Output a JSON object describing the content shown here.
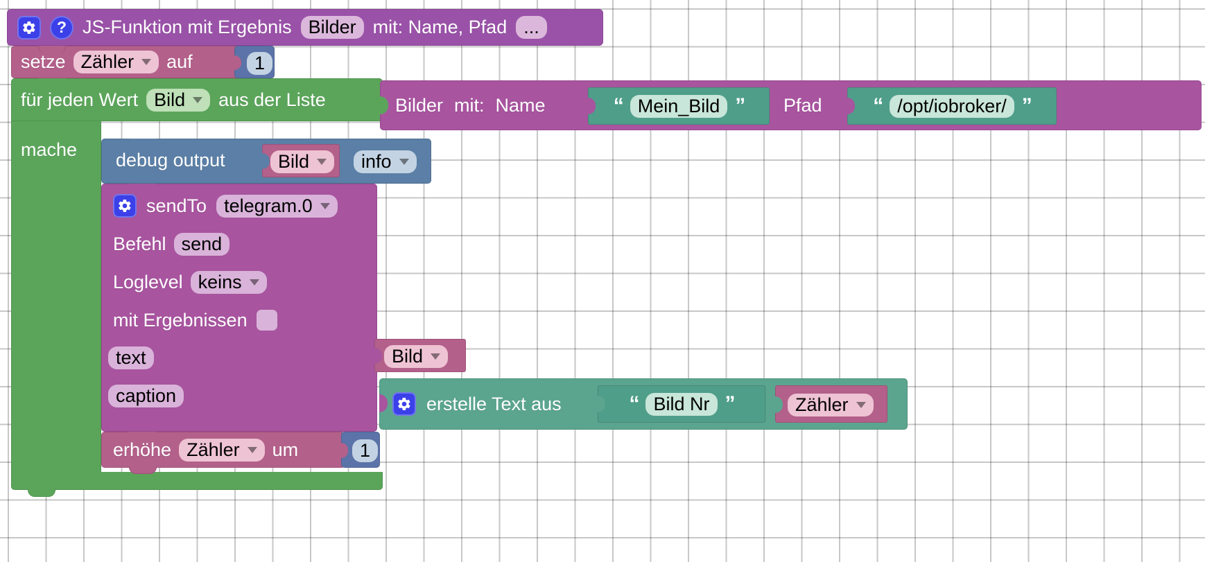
{
  "app": {
    "name": "ioBroker Blockly Editor",
    "language": "de"
  },
  "canvas": {
    "background": "#ffffff",
    "grid_dot_color": "#c9c9c9"
  },
  "colors": {
    "function_block": "#9a52a8",
    "variable_block": "#b3608a",
    "loop_block": "#5ba55b",
    "debug_block": "#5b7fa6",
    "sendto_block": "#a8549f",
    "text_block": "#5ba58e",
    "number_block": "#5b73a8",
    "string_value_block": "#4f9e8a",
    "icon_blue": "#3b40e8"
  },
  "blocks": {
    "function_def": {
      "name": "js-function-definition",
      "gear_icon": "gear-icon",
      "help_icon": "help-icon",
      "label": "JS-Funktion mit Ergebnis",
      "function_name": "Bilder",
      "params_label": "mit: Name, Pfad",
      "more_label": "..."
    },
    "set_variable": {
      "name": "set-variable",
      "label_prefix": "setze",
      "variable": "Zähler",
      "label_suffix": "auf",
      "value": "1"
    },
    "for_each": {
      "name": "for-each-loop",
      "label_prefix": "für jeden Wert",
      "variable": "Bild",
      "label_suffix": "aus der Liste",
      "do_label": "mache"
    },
    "call_function": {
      "name": "call-function-bilder",
      "function_name": "Bilder",
      "args_label": "mit:",
      "arg1_label": "Name",
      "arg1_value": "Mein_Bild",
      "arg2_label": "Pfad",
      "arg2_value": "/opt/iobroker/",
      "quote_open": "“",
      "quote_close": "”"
    },
    "debug_output": {
      "name": "debug-output",
      "label": "debug output",
      "value_variable": "Bild",
      "level": "info"
    },
    "send_to": {
      "name": "sendto-telegram",
      "gear_icon": "gear-icon",
      "label": "sendTo",
      "instance": "telegram.0",
      "command_label": "Befehl",
      "command_value": "send",
      "loglevel_label": "Loglevel",
      "loglevel_value": "keins",
      "with_results_label": "mit Ergebnissen",
      "with_results_checked": false,
      "text_label": "text",
      "text_value_variable": "Bild",
      "caption_label": "caption"
    },
    "create_text": {
      "name": "create-text-from",
      "gear_icon": "gear-icon",
      "label": "erstelle Text aus",
      "string_value": "Bild Nr",
      "variable": "Zähler",
      "quote_open": "“",
      "quote_close": "”"
    },
    "increment": {
      "name": "increment-variable",
      "label_prefix": "erhöhe",
      "variable": "Zähler",
      "label_suffix": "um",
      "value": "1"
    }
  }
}
